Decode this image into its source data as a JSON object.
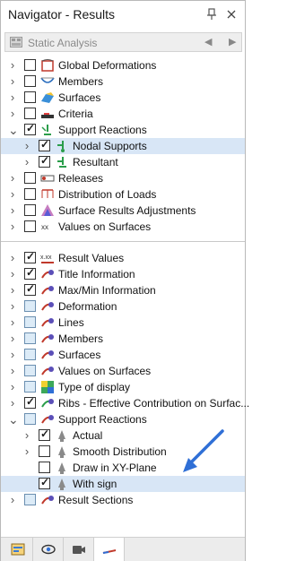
{
  "window": {
    "title": "Navigator - Results"
  },
  "dropdown": {
    "value": "Static Analysis"
  },
  "tree1": [
    {
      "label": "Global Deformations",
      "checked": false,
      "expander": "right",
      "indent": 0,
      "icon": "global-deformations-icon"
    },
    {
      "label": "Members",
      "checked": false,
      "expander": "right",
      "indent": 0,
      "icon": "members-icon"
    },
    {
      "label": "Surfaces",
      "checked": false,
      "expander": "right",
      "indent": 0,
      "icon": "surfaces-icon"
    },
    {
      "label": "Criteria",
      "checked": false,
      "expander": "right",
      "indent": 0,
      "icon": "criteria-icon"
    },
    {
      "label": "Support Reactions",
      "checked": true,
      "expander": "down",
      "indent": 0,
      "icon": "support-reactions-icon"
    },
    {
      "label": "Nodal Supports",
      "checked": true,
      "expander": "right",
      "indent": 1,
      "icon": "nodal-supports-icon",
      "selected": true
    },
    {
      "label": "Resultant",
      "checked": true,
      "expander": "right",
      "indent": 1,
      "icon": "resultant-icon"
    },
    {
      "label": "Releases",
      "checked": false,
      "expander": "right",
      "indent": 0,
      "icon": "releases-icon"
    },
    {
      "label": "Distribution of Loads",
      "checked": false,
      "expander": "right",
      "indent": 0,
      "icon": "distribution-of-loads-icon"
    },
    {
      "label": "Surface Results Adjustments",
      "checked": false,
      "expander": "right",
      "indent": 0,
      "icon": "surface-results-adjustments-icon"
    },
    {
      "label": "Values on Surfaces",
      "checked": false,
      "expander": "right",
      "indent": 0,
      "icon": "values-on-surfaces-icon"
    }
  ],
  "tree2": [
    {
      "label": "Result Values",
      "checked": true,
      "expander": "right",
      "indent": 0,
      "icon": "result-values-icon"
    },
    {
      "label": "Title Information",
      "checked": true,
      "expander": "right",
      "indent": 0,
      "icon": "title-information-icon"
    },
    {
      "label": "Max/Min Information",
      "checked": true,
      "expander": "right",
      "indent": 0,
      "icon": "maxmin-information-icon"
    },
    {
      "label": "Deformation",
      "checked": false,
      "tint": true,
      "expander": "right",
      "indent": 0,
      "icon": "deformation-icon"
    },
    {
      "label": "Lines",
      "checked": false,
      "tint": true,
      "expander": "right",
      "indent": 0,
      "icon": "lines-icon"
    },
    {
      "label": "Members",
      "checked": false,
      "tint": true,
      "expander": "right",
      "indent": 0,
      "icon": "members-display-icon"
    },
    {
      "label": "Surfaces",
      "checked": false,
      "tint": true,
      "expander": "right",
      "indent": 0,
      "icon": "surfaces-display-icon"
    },
    {
      "label": "Values on Surfaces",
      "checked": false,
      "tint": true,
      "expander": "right",
      "indent": 0,
      "icon": "values-on-surfaces-display-icon"
    },
    {
      "label": "Type of display",
      "checked": false,
      "tint": true,
      "expander": "right",
      "indent": 0,
      "icon": "type-of-display-icon"
    },
    {
      "label": "Ribs - Effective Contribution on Surfac...",
      "checked": true,
      "expander": "right",
      "indent": 0,
      "icon": "ribs-icon"
    },
    {
      "label": "Support Reactions",
      "checked": false,
      "tint": true,
      "expander": "down",
      "indent": 0,
      "icon": "support-reactions-display-icon"
    },
    {
      "label": "Actual",
      "checked": true,
      "expander": "right",
      "indent": 1,
      "icon": "actual-icon"
    },
    {
      "label": "Smooth Distribution",
      "checked": false,
      "expander": "right",
      "indent": 1,
      "icon": "smooth-distribution-icon"
    },
    {
      "label": "Draw in XY-Plane",
      "checked": false,
      "expander": "none",
      "indent": 1,
      "icon": "draw-xy-plane-icon"
    },
    {
      "label": "With sign",
      "checked": true,
      "expander": "none",
      "indent": 1,
      "icon": "with-sign-icon",
      "selected": true
    },
    {
      "label": "Result Sections",
      "checked": false,
      "tint": true,
      "expander": "right",
      "indent": 0,
      "icon": "result-sections-icon"
    }
  ],
  "bottom_tabs": [
    {
      "name": "data-tab",
      "icon": "data-icon"
    },
    {
      "name": "display-tab",
      "icon": "eye-icon"
    },
    {
      "name": "views-tab",
      "icon": "camera-icon"
    },
    {
      "name": "results-tab",
      "icon": "results-icon",
      "active": true
    }
  ],
  "colors": {
    "selection": "#d8e6f6",
    "annotation_arrow": "#2f6fd6"
  }
}
